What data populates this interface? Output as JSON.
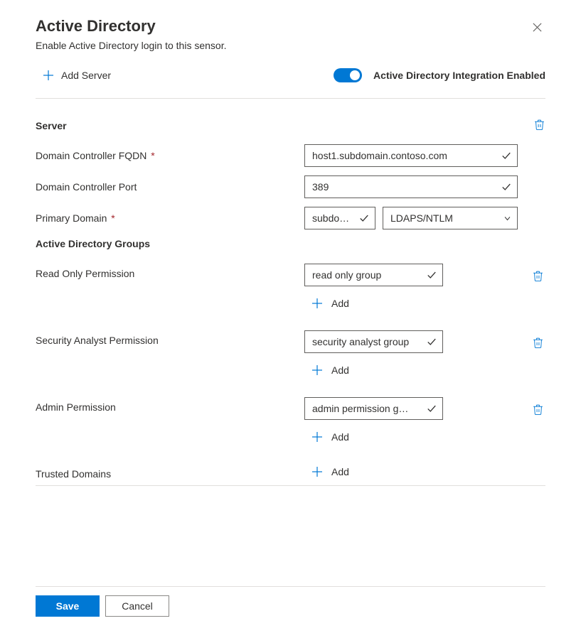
{
  "header": {
    "title": "Active Directory",
    "subtitle": "Enable Active Directory login to this sensor."
  },
  "top": {
    "add_server_label": "Add Server",
    "toggle_label": "Active Directory Integration Enabled",
    "toggle_state": "on"
  },
  "server": {
    "section_title": "Server",
    "fields": {
      "fqdn_label": "Domain Controller FQDN",
      "fqdn_required": "*",
      "fqdn_value": "host1.subdomain.contoso.com",
      "port_label": "Domain Controller Port",
      "port_value": "389",
      "primary_domain_label": "Primary Domain",
      "primary_domain_required": "*",
      "primary_domain_value": "subdo…",
      "auth_method_value": "LDAPS/NTLM"
    }
  },
  "groups": {
    "section_title": "Active Directory Groups",
    "read_only_label": "Read Only Permission",
    "read_only_value": "read only group",
    "security_analyst_label": "Security Analyst Permission",
    "security_analyst_value": "security analyst group",
    "admin_label": "Admin Permission",
    "admin_value": "admin permission g…",
    "trusted_domains_label": "Trusted Domains",
    "add_label": "Add"
  },
  "buttons": {
    "save": "Save",
    "cancel": "Cancel"
  },
  "icons": {
    "plus": "plus-icon",
    "close": "close-icon",
    "trash": "trash-icon",
    "check": "check-icon",
    "chevron_down": "chevron-down-icon"
  },
  "colors": {
    "accent": "#0078d4",
    "required": "#a4262c",
    "border": "#605e5c"
  }
}
